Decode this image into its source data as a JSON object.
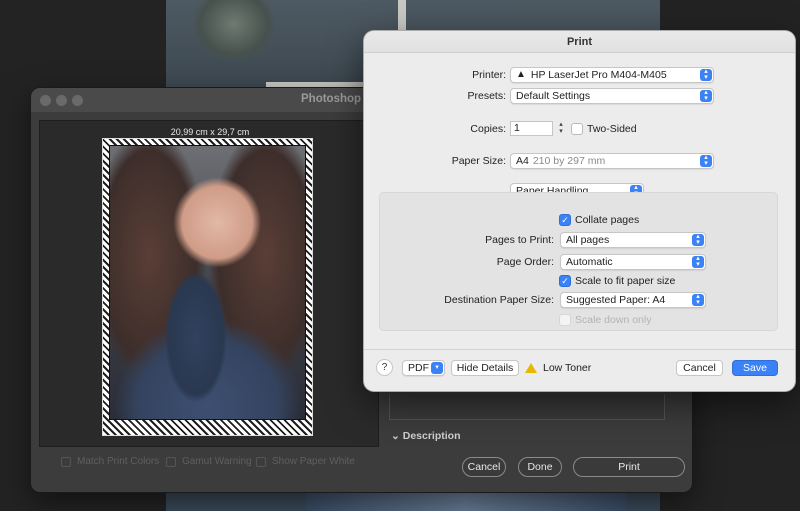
{
  "photoshop": {
    "window_title": "Photoshop Pr",
    "paper_dimensions": "20,99 cm x 29,7 cm",
    "checkboxes": [
      {
        "label": "Match Print Colors"
      },
      {
        "label": "Gamut Warning"
      },
      {
        "label": "Show Paper White"
      }
    ],
    "description_label": "Description",
    "buttons": {
      "cancel": "Cancel",
      "done": "Done",
      "print": "Print"
    }
  },
  "print_dialog": {
    "title": "Print",
    "printer": {
      "label": "Printer:",
      "value": "HP LaserJet Pro M404-M405",
      "warning_icon": "warning-triangle-icon"
    },
    "presets": {
      "label": "Presets:",
      "value": "Default Settings"
    },
    "copies": {
      "label": "Copies:",
      "value": "1",
      "two_sided_label": "Two-Sided",
      "two_sided_checked": false
    },
    "paper_size": {
      "label": "Paper Size:",
      "value": "A4",
      "detail": "210 by 297 mm"
    },
    "section_popup": "Paper Handling",
    "collate": {
      "label": "Collate pages",
      "checked": true
    },
    "pages_to_print": {
      "label": "Pages to Print:",
      "value": "All pages"
    },
    "page_order": {
      "label": "Page Order:",
      "value": "Automatic"
    },
    "scale_to_fit": {
      "label": "Scale to fit paper size",
      "checked": true
    },
    "destination_paper": {
      "label": "Destination Paper Size:",
      "value": "Suggested Paper: A4"
    },
    "scale_down_only": {
      "label": "Scale down only",
      "checked": false,
      "disabled": true
    },
    "footer": {
      "help": "?",
      "pdf": "PDF",
      "hide_details": "Hide Details",
      "status": "Low Toner",
      "cancel": "Cancel",
      "save": "Save"
    }
  },
  "colors": {
    "accent": "#3b82f6",
    "warning": "#e6b800"
  }
}
